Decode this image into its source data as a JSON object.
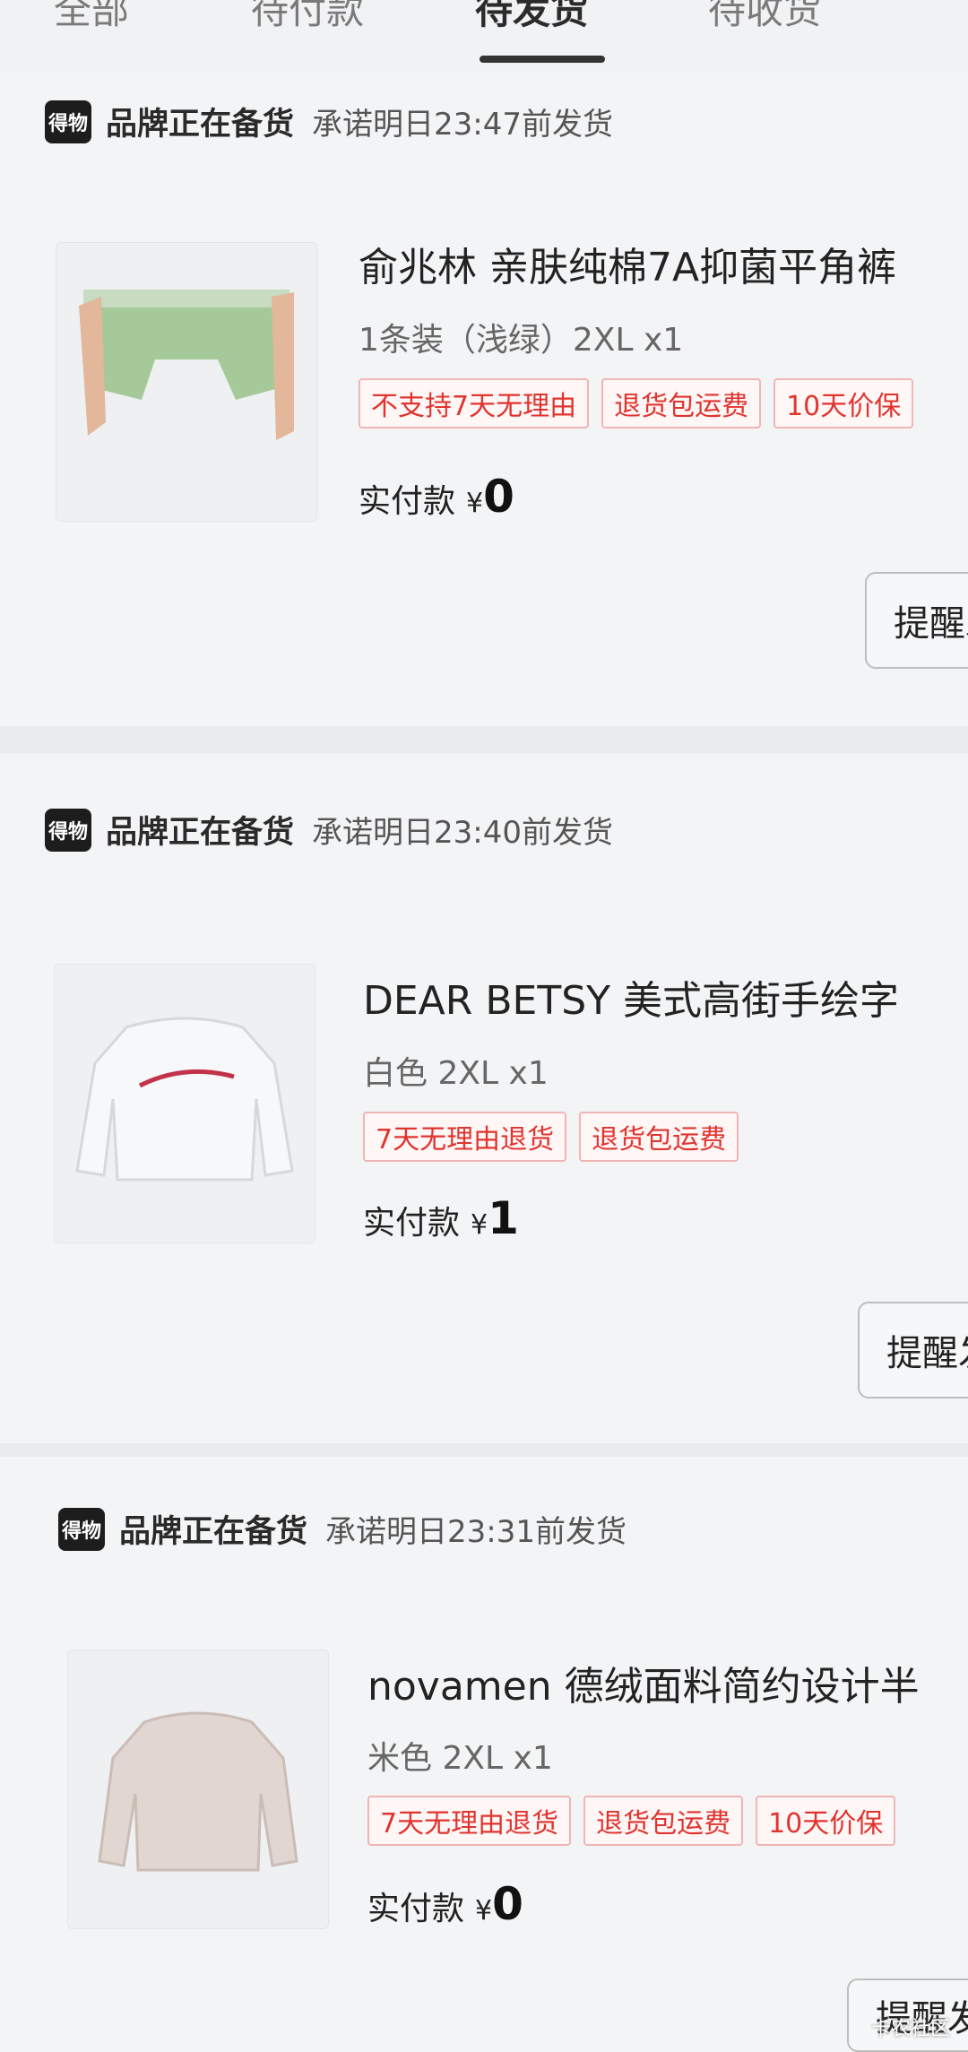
{
  "tabs": [
    {
      "label": "全部"
    },
    {
      "label": "待付款"
    },
    {
      "label": "待发货"
    },
    {
      "label": "待收货"
    }
  ],
  "orders": [
    {
      "brand_logo": "得物",
      "status": "品牌正在备货",
      "promise": "承诺明日23:47前发货",
      "title": "俞兆林 亲肤纯棉7A抑菌平角裤",
      "spec": "1条装（浅绿）2XL x1",
      "tags": [
        "不支持7天无理由",
        "退货包运费",
        "10天价保"
      ],
      "paid_label": "实付款",
      "currency": "¥",
      "amount": "0",
      "button": "提醒发货"
    },
    {
      "brand_logo": "得物",
      "status": "品牌正在备货",
      "promise": "承诺明日23:40前发货",
      "title": "DEAR BETSY 美式高街手绘字",
      "spec": "白色 2XL x1",
      "tags": [
        "7天无理由退货",
        "退货包运费"
      ],
      "paid_label": "实付款",
      "currency": "¥",
      "amount": "1",
      "button": "提醒发货"
    },
    {
      "brand_logo": "得物",
      "status": "品牌正在备货",
      "promise": "承诺明日23:31前发货",
      "title": "novamen 德绒面料简约设计半",
      "spec": "米色 2XL x1",
      "tags": [
        "7天无理由退货",
        "退货包运费",
        "10天价保"
      ],
      "paid_label": "实付款",
      "currency": "¥",
      "amount": "0",
      "button": "提醒发货"
    }
  ],
  "watermark": "卡农社区"
}
